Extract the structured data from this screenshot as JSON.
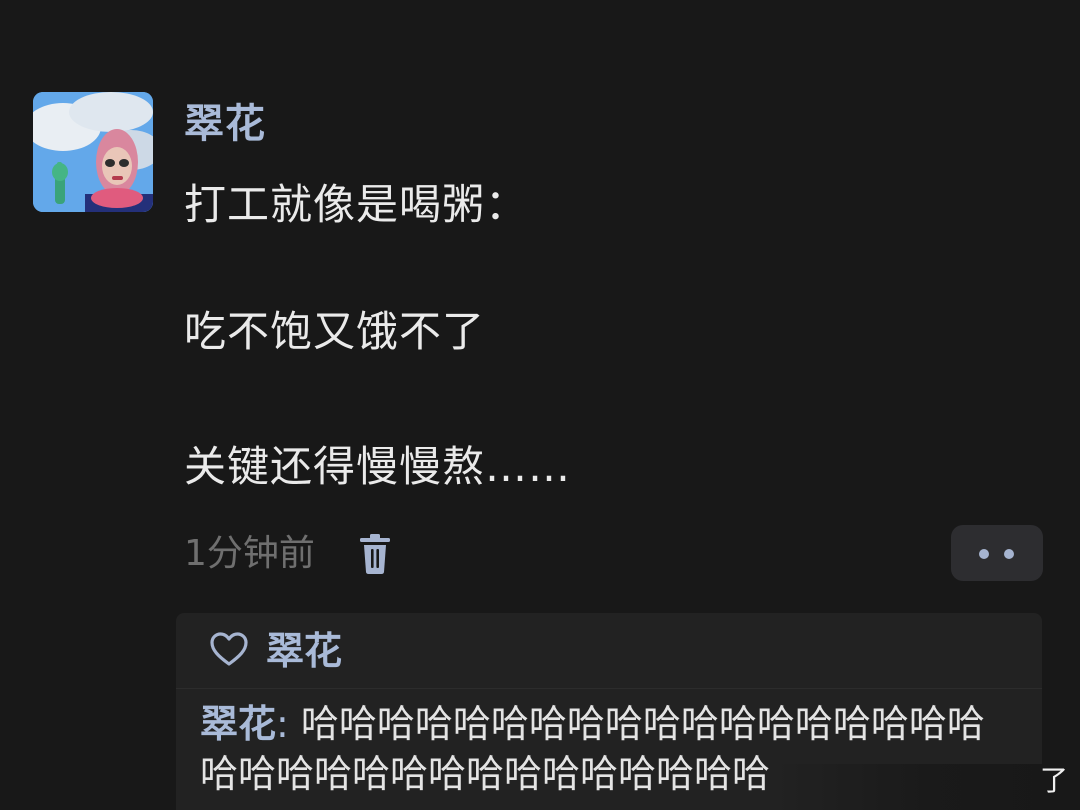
{
  "post": {
    "author": "翠花",
    "lines": [
      "打工就像是喝粥：",
      "吃不饱又饿不了",
      "关键还得慢慢熬……"
    ],
    "time": "1分钟前"
  },
  "likes": {
    "names": "翠花"
  },
  "comment": {
    "author": "翠花",
    "colon": ":",
    "text": "哈哈哈哈哈哈哈哈哈哈哈哈哈哈哈哈哈哈哈哈哈哈哈哈哈哈哈哈哈哈哈哈哈"
  },
  "corner_text": "了",
  "colors": {
    "background": "#181818",
    "name_blue": "#a9bad8",
    "muted_gray": "#6f6f6f",
    "panel": "#222222"
  },
  "icons": {
    "delete": "trash-icon",
    "more": "more-dots-icon",
    "like": "heart-icon"
  }
}
